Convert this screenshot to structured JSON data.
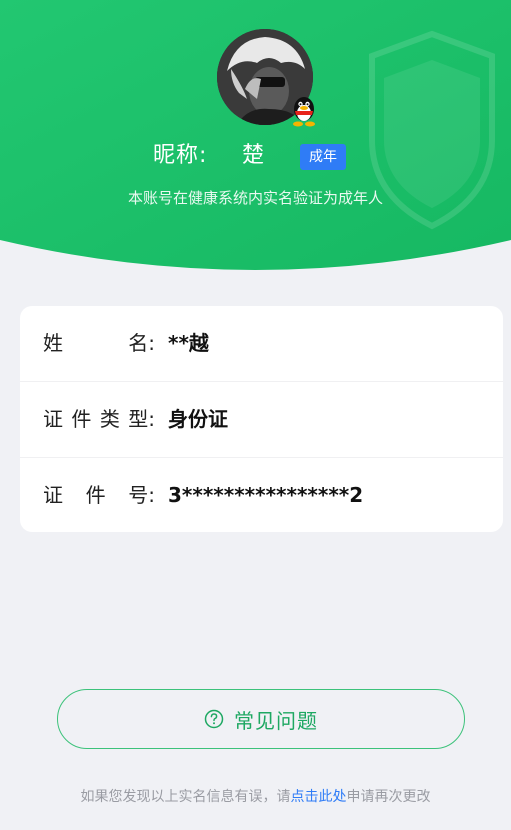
{
  "profile": {
    "nickname_label": "昵称:",
    "nickname_value": "楚",
    "age_badge": "成年",
    "verify_text": "本账号在健康系统内实名验证为成年人"
  },
  "info": {
    "rows": [
      {
        "label_chars": [
          "姓",
          "名:"
        ],
        "value": "**越"
      },
      {
        "label_chars": [
          "证",
          "件",
          "类",
          "型:"
        ],
        "value": "身份证"
      },
      {
        "label_chars": [
          "证",
          "件",
          "号:"
        ],
        "value": "3****************2"
      }
    ]
  },
  "faq": {
    "label": "常见问题",
    "icon": "question-circle-icon"
  },
  "footer": {
    "prefix": "如果您发现以上实名信息有误，请",
    "link": "点击此处",
    "suffix": "申请再次更改"
  },
  "colors": {
    "header_green": "#1fc26a",
    "accent_green": "#1ea862",
    "badge_blue": "#2f7cf6",
    "link_blue": "#2f7cf6",
    "page_bg": "#f0f1f5"
  }
}
